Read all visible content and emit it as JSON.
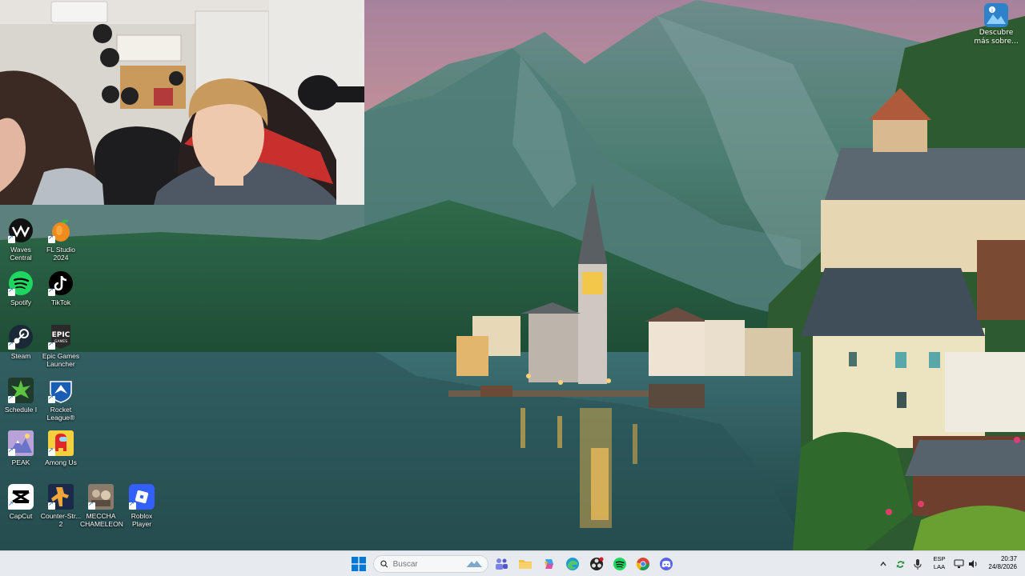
{
  "spotlight": {
    "label": "Descubre más sobre..."
  },
  "desktop_icons": [
    {
      "name": "waves-central",
      "label": "Waves Central"
    },
    {
      "name": "fl-studio",
      "label": "FL Studio 2024"
    },
    {
      "name": "spotify",
      "label": "Spotify"
    },
    {
      "name": "tiktok",
      "label": "TikTok"
    },
    {
      "name": "steam",
      "label": "Steam"
    },
    {
      "name": "epic-games",
      "label": "Epic Games Launcher"
    },
    {
      "name": "schedule-i",
      "label": "Schedule I"
    },
    {
      "name": "rocket-league",
      "label": "Rocket League®"
    },
    {
      "name": "peak",
      "label": "PEAK"
    },
    {
      "name": "among-us",
      "label": "Among Us"
    },
    {
      "name": "capcut",
      "label": "CapCut"
    },
    {
      "name": "counter-strike",
      "label": "Counter-Str... 2"
    },
    {
      "name": "meccha-chameleon",
      "label": "MECCHA CHAMELEON"
    },
    {
      "name": "roblox-player",
      "label": "Roblox Player"
    }
  ],
  "taskbar": {
    "search_placeholder": "Buscar",
    "apps": [
      "windows-start",
      "copilot",
      "teams",
      "file-explorer",
      "microsoft-copilot",
      "edge",
      "obs",
      "spotify",
      "chrome",
      "discord"
    ],
    "tray": {
      "language_line1": "ESP",
      "language_line2": "LAA",
      "time": "20:37",
      "date": "24/8/2026"
    }
  },
  "colors": {
    "taskbar_bg": "#e7ebef",
    "spotify_green": "#1ed760",
    "discord_blurple": "#5865f2",
    "windows_blue": "#0078d4"
  }
}
